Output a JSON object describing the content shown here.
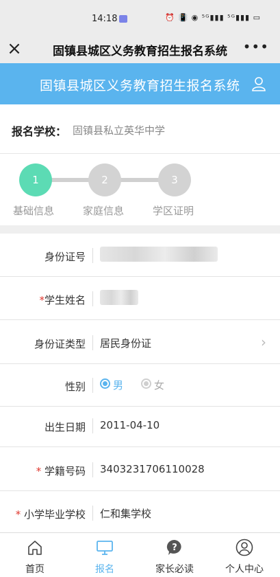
{
  "status_bar": {
    "time": "14:18",
    "icons_text": "⏰ 📳 ◉ ⁵ᴳ▮▮▮ ⁵ᴳ▮▮▮ ▭"
  },
  "title_bar": {
    "title": "固镇县城区义务教育招生报名系统",
    "close_label": "×",
    "more_label": "•••"
  },
  "banner": {
    "title": "固镇县城区义务教育招生报名系统"
  },
  "school": {
    "label": "报名学校：",
    "value": "固镇县私立英华中学"
  },
  "steps": [
    {
      "number": "1",
      "label": "基础信息",
      "active": true
    },
    {
      "number": "2",
      "label": "家庭信息",
      "active": false
    },
    {
      "number": "3",
      "label": "学区证明",
      "active": false
    }
  ],
  "form": {
    "id_number": {
      "label": "身份证号",
      "value": ""
    },
    "student_name": {
      "required_mark": "*",
      "label": "学生姓名",
      "value": ""
    },
    "id_type": {
      "label": "身份证类型",
      "value": "居民身份证"
    },
    "gender": {
      "label": "性别",
      "option_male": "男",
      "option_female": "女",
      "selected": "男"
    },
    "birth_date": {
      "label": "出生日期",
      "value": "2011-04-10"
    },
    "student_code": {
      "required_mark": "* ",
      "label": "学籍号码",
      "value": "3403231706110028"
    },
    "primary_school": {
      "required_mark": "* ",
      "label": "小学毕业学校",
      "value": "仁和集学校"
    }
  },
  "tabs": [
    {
      "label": "首页",
      "icon": "home-icon",
      "active": false
    },
    {
      "label": "报名",
      "icon": "monitor-icon",
      "active": true
    },
    {
      "label": "家长必读",
      "icon": "question-icon",
      "active": false
    },
    {
      "label": "个人中心",
      "icon": "person-icon",
      "active": false
    }
  ],
  "colors": {
    "accent": "#5ab4ee",
    "step_active": "#5cdbb4",
    "required": "#e0382f"
  }
}
